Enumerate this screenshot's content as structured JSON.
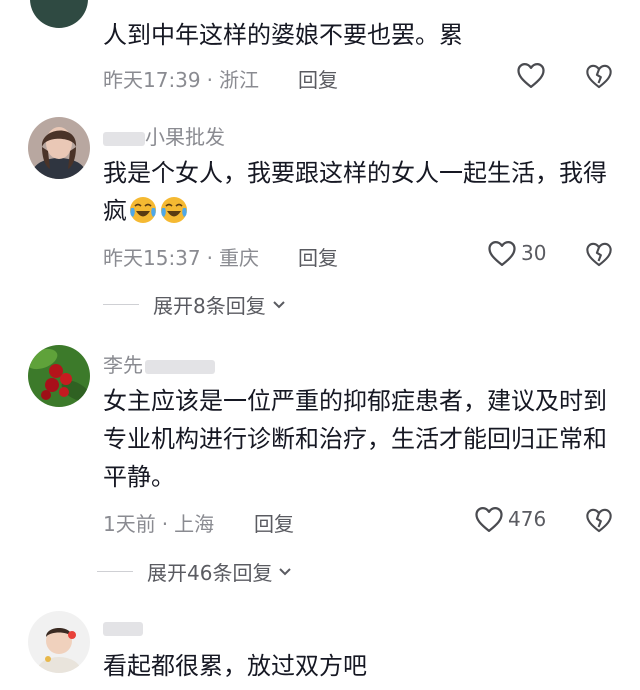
{
  "comments": [
    {
      "text": "人到中年这样的婆娘不要也罢。累",
      "time": "昨天17:39",
      "location": "浙江",
      "reply_label": "回复",
      "likes": ""
    },
    {
      "username": "小果批发",
      "text": "我是个女人，我要跟这样的女人一起生活，我得疯",
      "emoji_icons": [
        "crying-laughing-emoji",
        "crying-laughing-emoji"
      ],
      "time": "昨天15:37",
      "location": "重庆",
      "reply_label": "回复",
      "likes": "30",
      "expand_label": "展开8条回复"
    },
    {
      "username": "李先",
      "text": "女主应该是一位严重的抑郁症患者，建议及时到专业机构进行诊断和治疗，生活才能回归正常和平静。",
      "time": "1天前",
      "location": "上海",
      "reply_label": "回复",
      "likes": "476",
      "expand_label": "展开46条回复"
    },
    {
      "username": "",
      "text": "看起都很累，放过双方吧"
    }
  ],
  "separator": "·",
  "colors": {
    "text": "#161823",
    "meta": "#8a8b91",
    "secondary": "#5a5b61",
    "emoji": "#f5b932"
  }
}
